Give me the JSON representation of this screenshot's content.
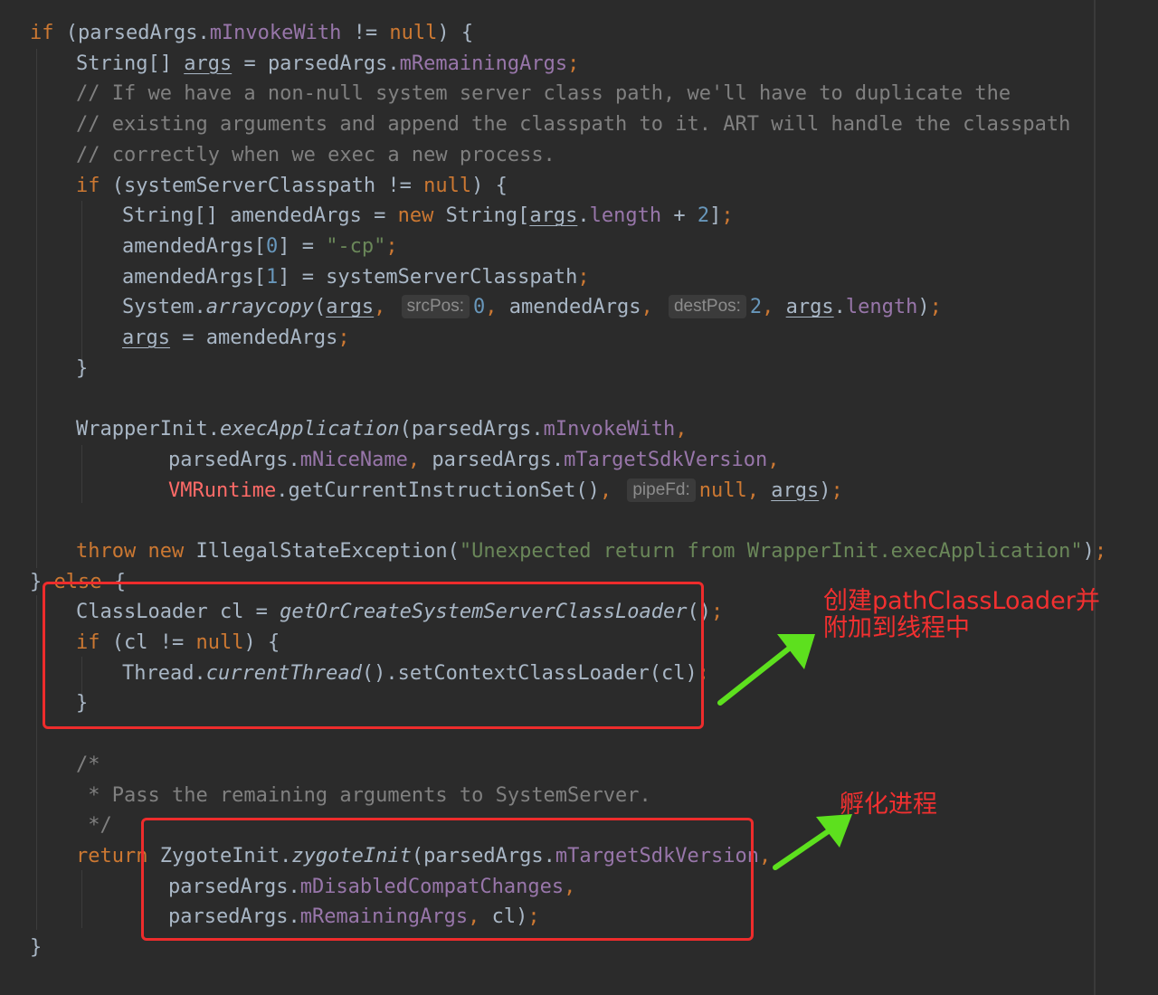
{
  "code": {
    "lines": [
      {
        "indent": 0,
        "tokens": [
          [
            "kw",
            "if"
          ],
          [
            "pl",
            " (parsedArgs."
          ],
          [
            "fld",
            "mInvokeWith"
          ],
          [
            "pl",
            " != "
          ],
          [
            "kw",
            "null"
          ],
          [
            "pl",
            ") {"
          ]
        ]
      },
      {
        "indent": 1,
        "tokens": [
          [
            "pl",
            "String[] "
          ],
          [
            "ul",
            "args"
          ],
          [
            "pl",
            " = parsedArgs."
          ],
          [
            "fld",
            "mRemainingArgs"
          ],
          [
            "kw",
            ";"
          ]
        ]
      },
      {
        "indent": 1,
        "tokens": [
          [
            "cm",
            "// If we have a non-null system server class path, we'll have to duplicate the"
          ]
        ]
      },
      {
        "indent": 1,
        "tokens": [
          [
            "cm",
            "// existing arguments and append the classpath to it. ART will handle the classpath"
          ]
        ]
      },
      {
        "indent": 1,
        "tokens": [
          [
            "cm",
            "// correctly when we exec a new process."
          ]
        ]
      },
      {
        "indent": 1,
        "tokens": [
          [
            "kw",
            "if"
          ],
          [
            "pl",
            " (systemServerClasspath != "
          ],
          [
            "kw",
            "null"
          ],
          [
            "pl",
            ") {"
          ]
        ]
      },
      {
        "indent": 2,
        "tokens": [
          [
            "pl",
            "String[] amendedArgs = "
          ],
          [
            "kw",
            "new"
          ],
          [
            "pl",
            " String["
          ],
          [
            "ul",
            "args"
          ],
          [
            "pl",
            "."
          ],
          [
            "fld",
            "length"
          ],
          [
            "pl",
            " + "
          ],
          [
            "num",
            "2"
          ],
          [
            "pl",
            "]"
          ],
          [
            "kw",
            ";"
          ]
        ]
      },
      {
        "indent": 2,
        "tokens": [
          [
            "pl",
            "amendedArgs["
          ],
          [
            "num",
            "0"
          ],
          [
            "pl",
            "] = "
          ],
          [
            "str",
            "\"-cp\""
          ],
          [
            "kw",
            ";"
          ]
        ]
      },
      {
        "indent": 2,
        "tokens": [
          [
            "pl",
            "amendedArgs["
          ],
          [
            "num",
            "1"
          ],
          [
            "pl",
            "] = systemServerClasspath"
          ],
          [
            "kw",
            ";"
          ]
        ]
      },
      {
        "indent": 2,
        "tokens": [
          [
            "pl",
            "System."
          ],
          [
            "it",
            "arraycopy"
          ],
          [
            "pl",
            "("
          ],
          [
            "ul",
            "args"
          ],
          [
            "kw",
            ", "
          ],
          [
            "hint",
            "srcPos:"
          ],
          [
            "num",
            "0"
          ],
          [
            "kw",
            ", "
          ],
          [
            "pl",
            "amendedArgs"
          ],
          [
            "kw",
            ", "
          ],
          [
            "hint",
            "destPos:"
          ],
          [
            "num",
            "2"
          ],
          [
            "kw",
            ", "
          ],
          [
            "ul",
            "args"
          ],
          [
            "pl",
            "."
          ],
          [
            "fld",
            "length"
          ],
          [
            "pl",
            ")"
          ],
          [
            "kw",
            ";"
          ]
        ]
      },
      {
        "indent": 2,
        "tokens": [
          [
            "ul",
            "args"
          ],
          [
            "pl",
            " = amendedArgs"
          ],
          [
            "kw",
            ";"
          ]
        ]
      },
      {
        "indent": 1,
        "tokens": [
          [
            "pl",
            "}"
          ]
        ]
      },
      {
        "indent": 0,
        "tokens": []
      },
      {
        "indent": 1,
        "tokens": [
          [
            "pl",
            "WrapperInit."
          ],
          [
            "it",
            "execApplication"
          ],
          [
            "pl",
            "(parsedArgs."
          ],
          [
            "fld",
            "mInvokeWith"
          ],
          [
            "kw",
            ","
          ]
        ]
      },
      {
        "indent": 3,
        "tokens": [
          [
            "pl",
            "parsedArgs."
          ],
          [
            "fld",
            "mNiceName"
          ],
          [
            "kw",
            ", "
          ],
          [
            "pl",
            "parsedArgs."
          ],
          [
            "fld",
            "mTargetSdkVersion"
          ],
          [
            "kw",
            ","
          ]
        ]
      },
      {
        "indent": 3,
        "tokens": [
          [
            "red",
            "VMRuntime"
          ],
          [
            "pl",
            ".getCurrentInstructionSet()"
          ],
          [
            "kw",
            ", "
          ],
          [
            "hint",
            "pipeFd:"
          ],
          [
            "kw",
            "null"
          ],
          [
            "kw",
            ", "
          ],
          [
            "ul",
            "args"
          ],
          [
            "pl",
            ")"
          ],
          [
            "kw",
            ";"
          ]
        ]
      },
      {
        "indent": 0,
        "tokens": []
      },
      {
        "indent": 1,
        "tokens": [
          [
            "kw",
            "throw new "
          ],
          [
            "pl",
            "IllegalStateException("
          ],
          [
            "str",
            "\"Unexpected return from WrapperInit.execApplication\""
          ],
          [
            "pl",
            ")"
          ],
          [
            "kw",
            ";"
          ]
        ]
      },
      {
        "indent": 0,
        "tokens": [
          [
            "pl",
            "} "
          ],
          [
            "kw",
            "else"
          ],
          [
            "pl",
            " {"
          ]
        ]
      },
      {
        "indent": 1,
        "tokens": [
          [
            "pl",
            "ClassLoader cl = "
          ],
          [
            "it",
            "getOrCreateSystemServerClassLoader"
          ],
          [
            "pl",
            "()"
          ],
          [
            "kw",
            ";"
          ]
        ]
      },
      {
        "indent": 1,
        "tokens": [
          [
            "kw",
            "if"
          ],
          [
            "pl",
            " (cl != "
          ],
          [
            "kw",
            "null"
          ],
          [
            "pl",
            ") {"
          ]
        ]
      },
      {
        "indent": 2,
        "tokens": [
          [
            "pl",
            "Thread."
          ],
          [
            "it",
            "currentThread"
          ],
          [
            "pl",
            "().setContextClassLoader(cl)"
          ],
          [
            "kw",
            ";"
          ]
        ]
      },
      {
        "indent": 1,
        "tokens": [
          [
            "pl",
            "}"
          ]
        ]
      },
      {
        "indent": 0,
        "tokens": []
      },
      {
        "indent": 1,
        "tokens": [
          [
            "cm",
            "/*"
          ]
        ]
      },
      {
        "indent": 1,
        "tokens": [
          [
            "cm",
            " * Pass the remaining arguments to SystemServer."
          ]
        ]
      },
      {
        "indent": 1,
        "tokens": [
          [
            "cm",
            " */"
          ]
        ]
      },
      {
        "indent": 1,
        "tokens": [
          [
            "kw",
            "return "
          ],
          [
            "pl",
            "ZygoteInit."
          ],
          [
            "it",
            "zygoteInit"
          ],
          [
            "pl",
            "(parsedArgs."
          ],
          [
            "fld",
            "mTargetSdkVersion"
          ],
          [
            "kw",
            ","
          ]
        ]
      },
      {
        "indent": 3,
        "tokens": [
          [
            "pl",
            "parsedArgs."
          ],
          [
            "fld",
            "mDisabledCompatChanges"
          ],
          [
            "kw",
            ","
          ]
        ]
      },
      {
        "indent": 3,
        "tokens": [
          [
            "pl",
            "parsedArgs."
          ],
          [
            "fld",
            "mRemainingArgs"
          ],
          [
            "kw",
            ", "
          ],
          [
            "pl",
            "cl)"
          ],
          [
            "kw",
            ";"
          ]
        ]
      },
      {
        "indent": 0,
        "tokens": [
          [
            "pl",
            "}"
          ]
        ]
      }
    ]
  },
  "annotations": {
    "note1": "创建pathClassLoader并\n附加到线程中",
    "note2": "孵化进程",
    "box_color": "#ee2c2c",
    "arrow_color": "#5de01e"
  },
  "colors": {
    "background": "#2b2b2b",
    "keyword": "#cc7832",
    "text": "#a9b7c6",
    "field": "#9876aa",
    "comment": "#808080",
    "string": "#6a8759",
    "number": "#6897bb"
  }
}
